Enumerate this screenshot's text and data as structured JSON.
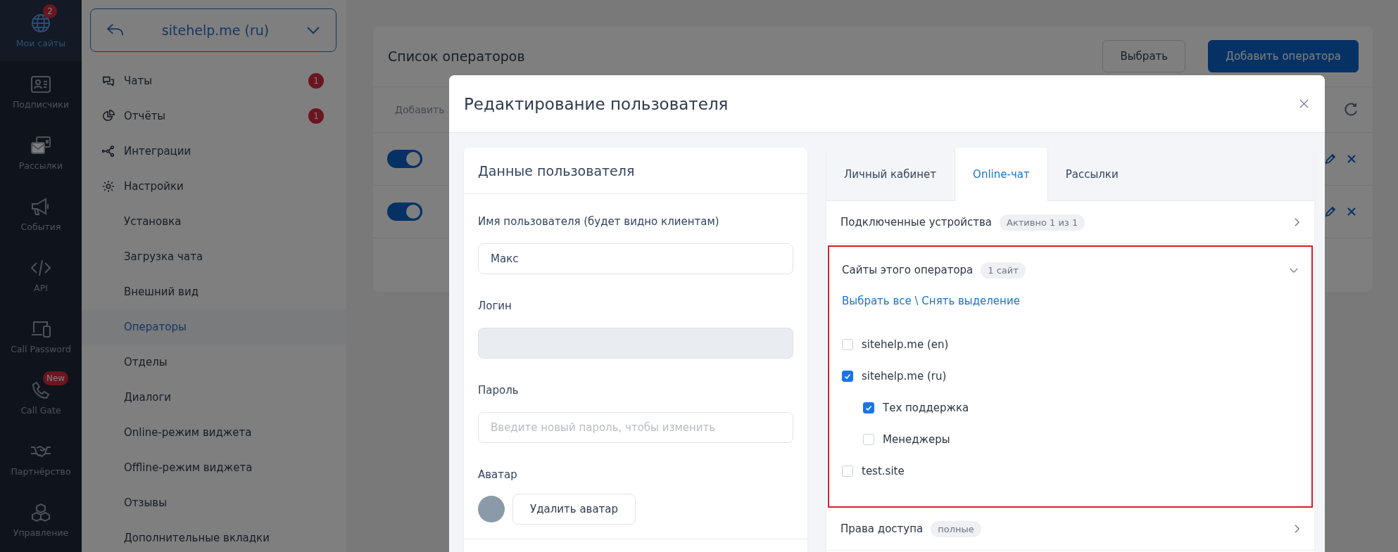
{
  "nav": [
    {
      "label": "Мои сайты",
      "badge": "2",
      "selected": true
    },
    {
      "label": "Подписчики",
      "selected": false
    },
    {
      "label": "Рассылки",
      "selected": false
    },
    {
      "label": "События",
      "selected": false
    },
    {
      "label": "API",
      "selected": false
    },
    {
      "label": "Call Password",
      "selected": false
    },
    {
      "label": "Call Gate",
      "badge": "New",
      "selected": false
    },
    {
      "label": "Партнёрство",
      "selected": false
    },
    {
      "label": "Управление",
      "selected": false
    }
  ],
  "site_selector": {
    "value": "sitehelp.me (ru)"
  },
  "sidebar": {
    "items": [
      {
        "label": "Чаты",
        "badge": "1",
        "selected": false
      },
      {
        "label": "Отчёты",
        "badge": "1",
        "selected": false
      },
      {
        "label": "Интеграции",
        "selected": false
      },
      {
        "label": "Настройки",
        "selected": false,
        "children": [
          {
            "label": "Установка",
            "selected": false
          },
          {
            "label": "Загрузка чата",
            "selected": false
          },
          {
            "label": "Внешний вид",
            "selected": false
          },
          {
            "label": "Операторы",
            "selected": true
          },
          {
            "label": "Отделы",
            "selected": false
          },
          {
            "label": "Диалоги",
            "selected": false
          },
          {
            "label": "Online-режим виджета",
            "selected": false
          },
          {
            "label": "Offline-режим виджета",
            "selected": false
          },
          {
            "label": "Отзывы",
            "selected": false
          },
          {
            "label": "Дополнительные вкладки",
            "selected": false
          }
        ]
      }
    ]
  },
  "operators_card": {
    "title": "Список операторов",
    "buttons": [
      {
        "label": "Выбрать",
        "kind": "secondary"
      },
      {
        "label": "Добавить оператора",
        "kind": "primary"
      }
    ],
    "toolbar_text": "Добавить",
    "rows": [
      {
        "on": true
      },
      {
        "on": true
      }
    ]
  },
  "modal": {
    "title": "Редактирование пользователя",
    "user_card": {
      "title": "Данные пользователя",
      "fields": [
        {
          "label": "Имя пользователя (будет видно клиентам)",
          "value": "Макс",
          "disabled": false
        },
        {
          "label": "Логин",
          "disabled": true
        },
        {
          "label": "Пароль",
          "placeholder": "Введите новый пароль, чтобы изменить",
          "disabled": false
        }
      ],
      "avatar_label": "Аватар",
      "avatar_button": "Удалить аватар"
    },
    "tabs": [
      {
        "label": "Личный кабинет",
        "selected": false
      },
      {
        "label": "Online-чат",
        "selected": true
      },
      {
        "label": "Рассылки",
        "selected": false
      }
    ],
    "sections": [
      {
        "title": "Подключенные устройства",
        "pill": "Активно 1 из 1",
        "expanded": false,
        "highlighted": false
      },
      {
        "title": "Сайты этого оператора",
        "pill": "1 сайт",
        "expanded": true,
        "highlighted": true,
        "select_link": "Выбрать все \\ Снять выделение",
        "sites": [
          {
            "label": "sitehelp.me (en)",
            "checked": false
          },
          {
            "label": "sitehelp.me (ru)",
            "checked": true,
            "children": [
              {
                "label": "Тех поддержка",
                "checked": true
              },
              {
                "label": "Менеджеры",
                "checked": false
              }
            ]
          },
          {
            "label": "test.site",
            "checked": false
          }
        ]
      },
      {
        "title": "Права доступа",
        "pill": "полные",
        "expanded": false,
        "highlighted": false
      }
    ]
  }
}
